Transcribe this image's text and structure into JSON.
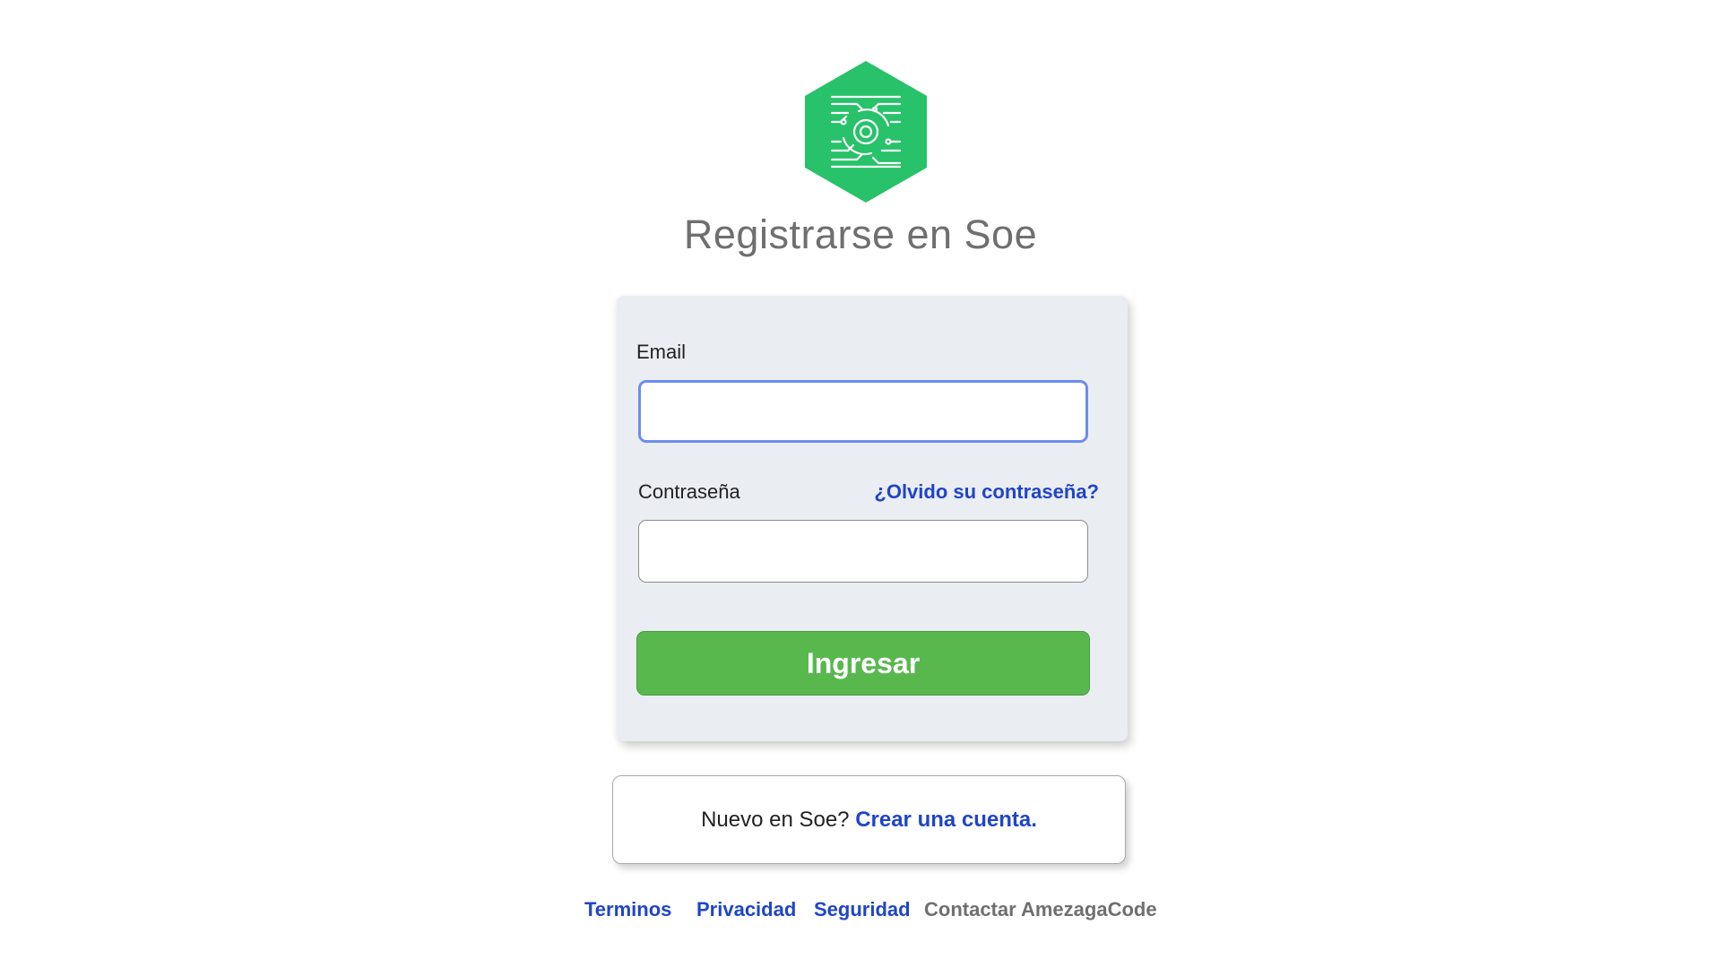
{
  "header": {
    "title": "Registrarse en Soe"
  },
  "colors": {
    "brand_green": "#27c269",
    "button_green": "#58b84e",
    "link_blue": "#1f45c7"
  },
  "login_form": {
    "email_label": "Email",
    "email_value": "",
    "password_label": "Contraseña",
    "password_value": "",
    "forgot_link": "¿Olvido su contraseña?",
    "submit_label": "Ingresar"
  },
  "signup": {
    "prompt": "Nuevo en Soe? ",
    "link": "Crear una cuenta."
  },
  "footer": {
    "terms": "Terminos",
    "privacy": "Privacidad",
    "security": "Seguridad",
    "contact": "Contactar AmezagaCode"
  }
}
